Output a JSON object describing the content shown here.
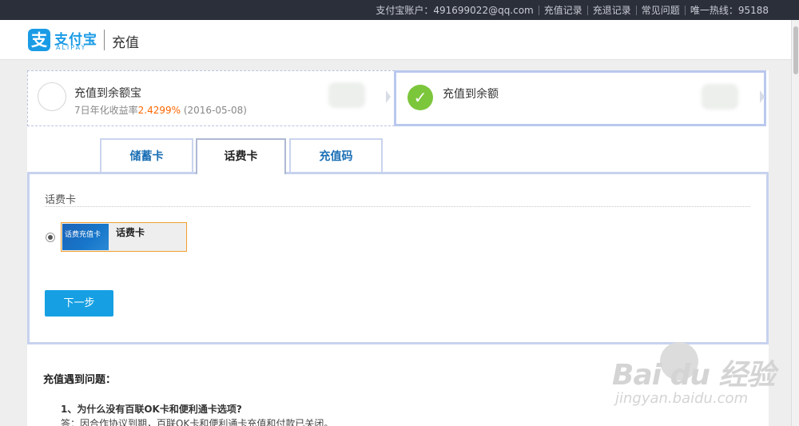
{
  "topbar": {
    "account": "支付宝账户：491699022@qq.com",
    "links": [
      "充值记录",
      "充退记录",
      "常见问题"
    ],
    "hotline": "唯一热线：95188"
  },
  "header": {
    "logo_icon": "支",
    "logo_cn": "支付宝",
    "logo_en": "ALIPAY",
    "title": "充值"
  },
  "options": {
    "yuebao": {
      "title": "充值到余额宝",
      "sub_prefix": "7日年化收益率",
      "rate": "2.4299%",
      "date": " (2016-05-08)"
    },
    "balance": {
      "title": "充值到余额",
      "check": "✓"
    }
  },
  "tabs": [
    {
      "label": "储蓄卡"
    },
    {
      "label": "话费卡"
    },
    {
      "label": "充值码"
    }
  ],
  "content": {
    "section_label": "话费卡",
    "card_thumb_text": "话费充值卡",
    "card_name": "话费卡",
    "next_button": "下一步"
  },
  "help": {
    "title": "充值遇到问题：",
    "q1": "1、为什么没有百联OK卡和便利通卡选项?",
    "a1": "答：因合作协议到期，百联OK卡和便利通卡充值和付款已关闭。"
  },
  "watermark": {
    "logo": "Bai  du 经验",
    "url": "jingyan.baidu.com"
  },
  "colors": {
    "topbar_bg": "#2b2f3a",
    "brand": "#1a9be6",
    "accent_orange": "#ff6600",
    "check_green": "#7cc63c",
    "button_blue": "#16a0e3"
  }
}
